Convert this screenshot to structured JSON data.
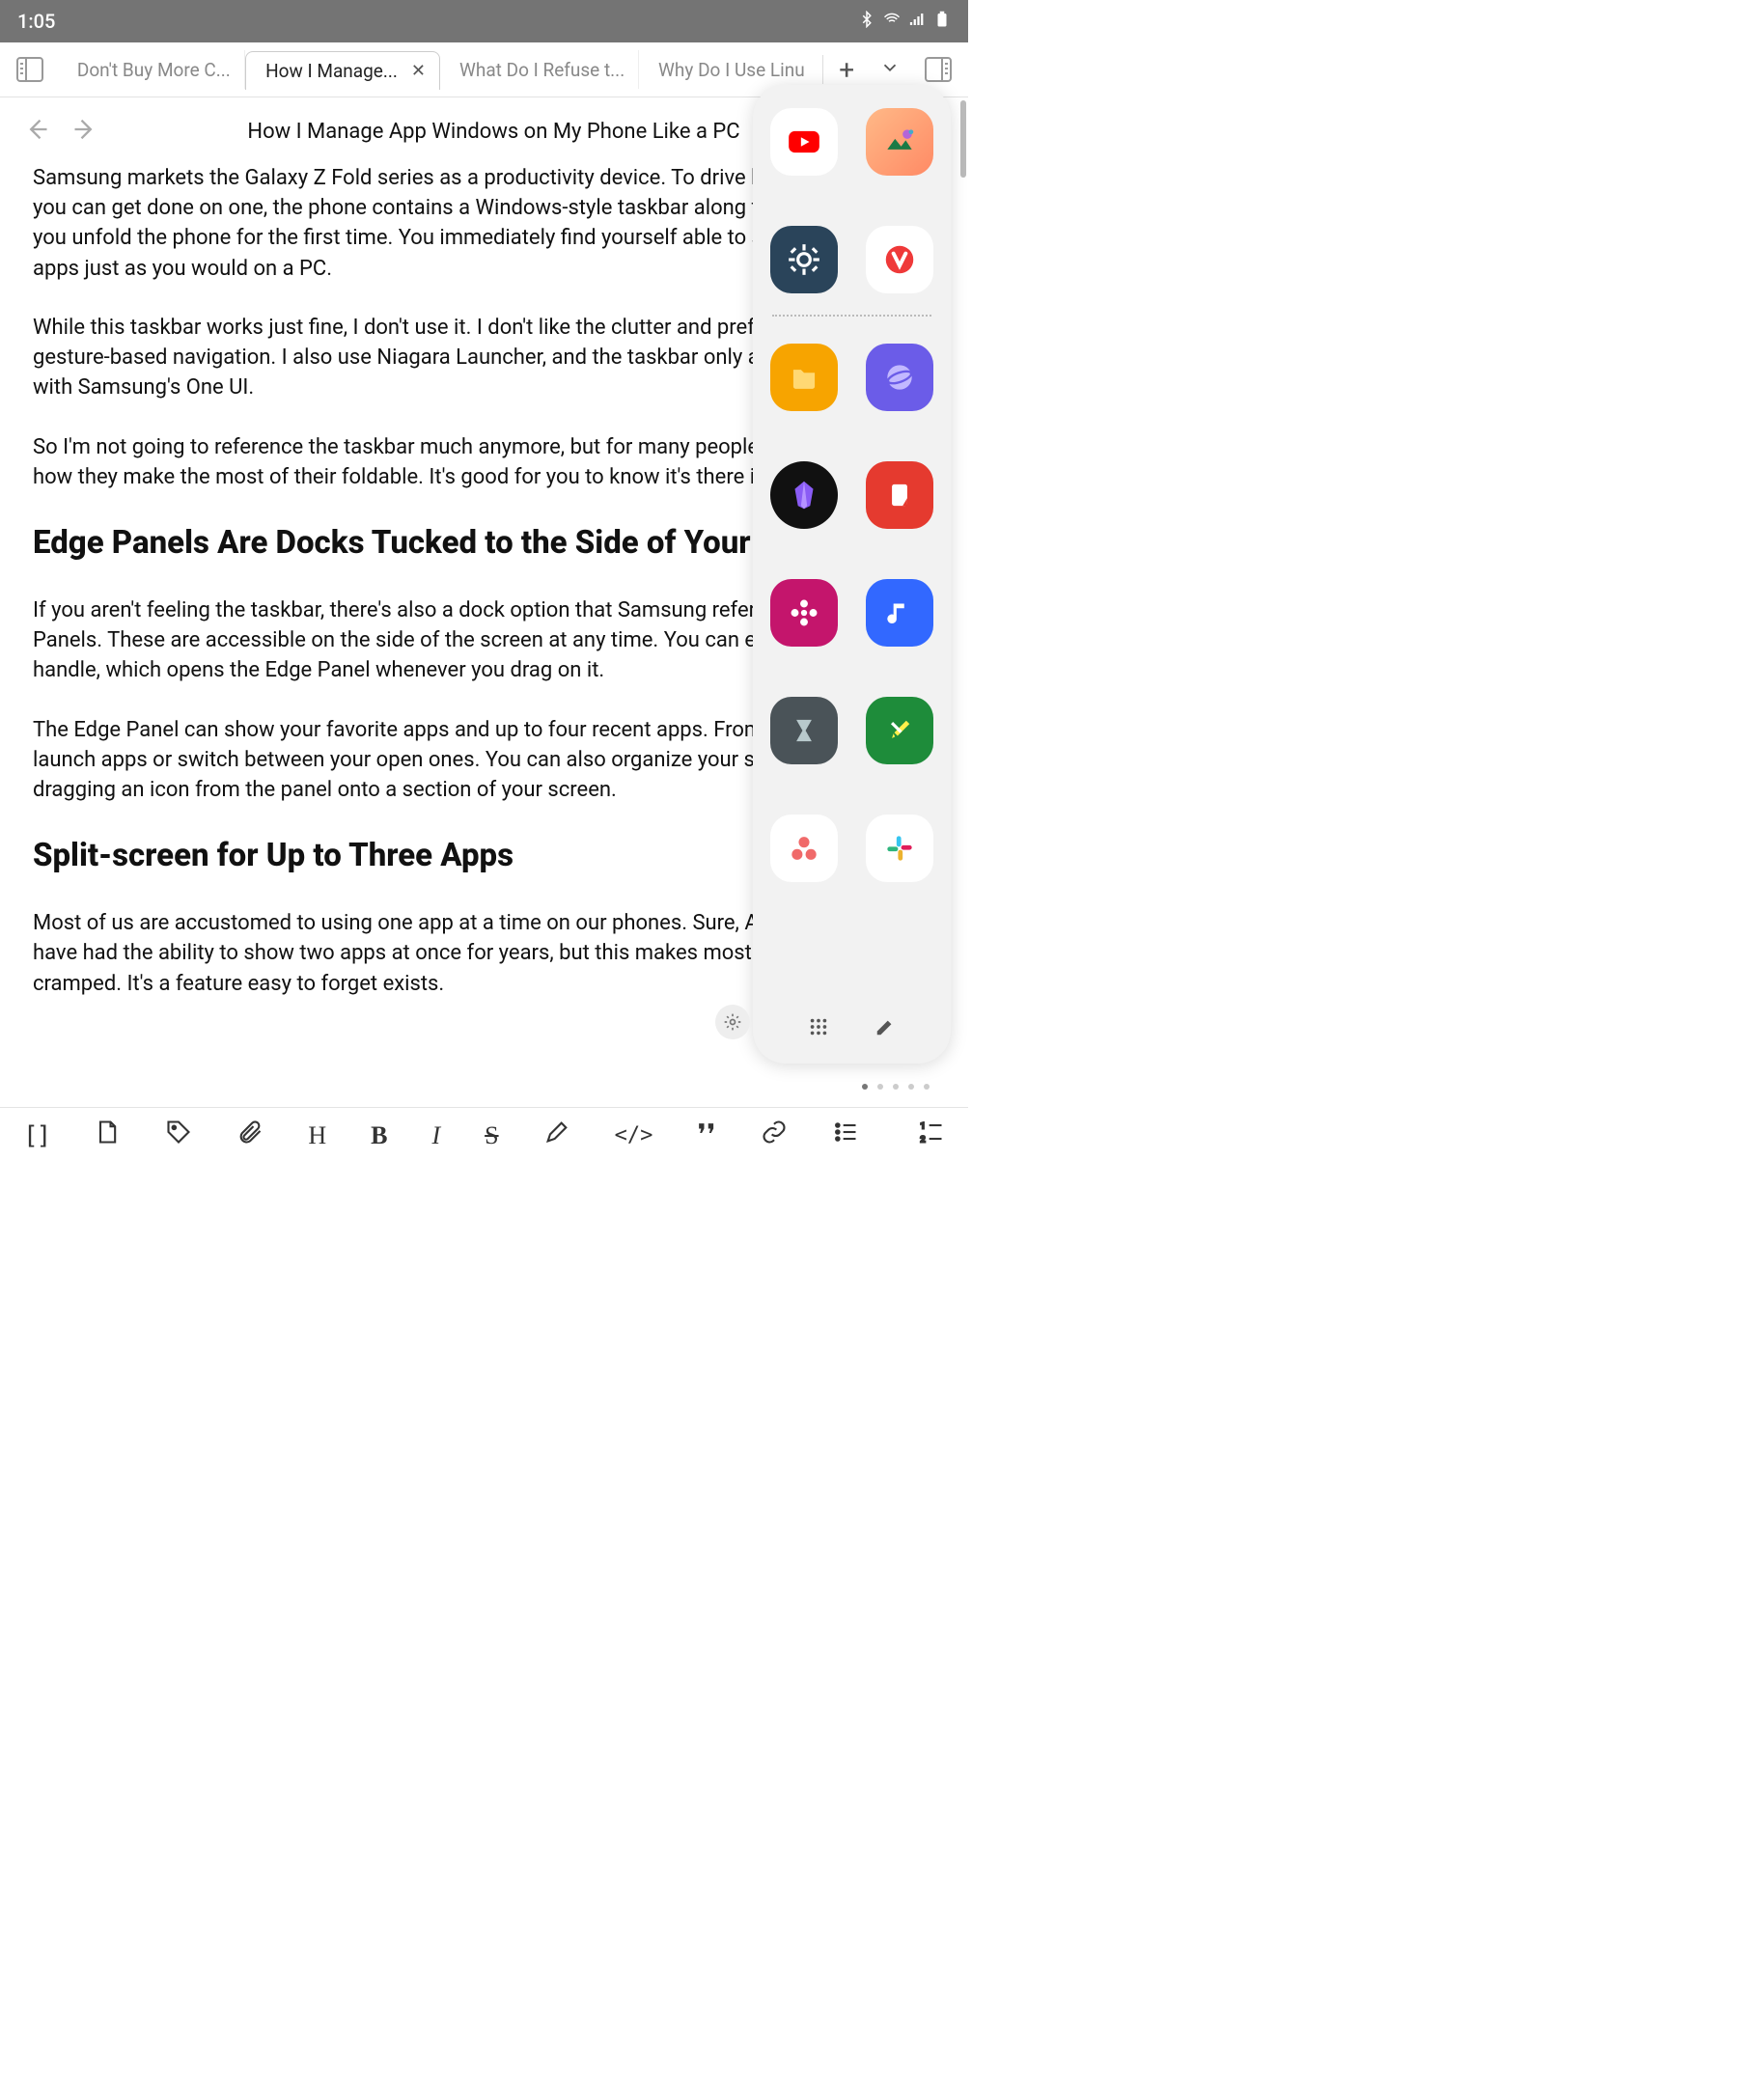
{
  "status": {
    "time": "1:05",
    "bluetooth": true,
    "wifi": "6",
    "signal": true,
    "battery": true
  },
  "tabs": {
    "items": [
      {
        "label": "Don't Buy More C...",
        "active": false
      },
      {
        "label": "How I Manage...",
        "active": true
      },
      {
        "label": "What Do I Refuse t...",
        "active": false
      },
      {
        "label": "Why Do I Use Linu",
        "active": false
      }
    ]
  },
  "page": {
    "title": "How I Manage App Windows on My Phone Like a PC"
  },
  "content": {
    "p1": "Samsung markets the Galaxy Z Fold series as a productivity device. To drive home how much you can get done on one, the phone contains a Windows-style taskbar along the bottom when you unfold the phone for the first time. You immediately find yourself able to switch between apps just as you would on a PC.",
    "p2": "While this taskbar works just fine, I don't use it. I don't like the clutter and prefer sticking with gesture-based navigation. I also use Niagara Launcher, and the taskbar only appears if you stick with Samsung's One UI.",
    "p3": "So I'm not going to reference the taskbar much anymore, but for many people, it's a core part of how they make the most of their foldable. It's good for you to know it's there in case you want it.",
    "h2a": "Edge Panels Are Docks Tucked to the Side of Your Screen",
    "p4": "If you aren't feeling the taskbar, there's also a dock option that Samsung refers to as Edge Panels. These are accessible on the side of the screen at any time. You can enable a small handle, which opens the Edge Panel whenever you drag on it.",
    "p5": "The Edge Panel can show your favorite apps and up to four recent apps. From here, you can launch apps or switch between your open ones. You can also organize your split-screen by dragging an icon from the panel onto a section of your screen.",
    "h2b": "Split-screen for Up to Three Apps",
    "p6": "Most of us are accustomed to using one app at a time on our phones. Sure, Android phones have had the ability to show two apps at once for years, but this makes most phones feel cramped. It's a feature easy to forget exists."
  },
  "edge_panel": {
    "recent": [
      {
        "name": "YouTube",
        "bg": "#ffffff",
        "accent": "#ff0000"
      },
      {
        "name": "Game",
        "bg": "#f5a05a",
        "accent": "#2aa36a"
      },
      {
        "name": "Settings",
        "bg": "#2a445a",
        "accent": "#ffffff"
      },
      {
        "name": "Vivaldi",
        "bg": "#ffffff",
        "accent": "#ef3939"
      }
    ],
    "apps": [
      {
        "name": "Files",
        "bg": "#f7a400",
        "accent": "#ffd873"
      },
      {
        "name": "Internet",
        "bg": "#6b5ce8",
        "accent": "#c2b8ff"
      },
      {
        "name": "Obsidian",
        "bg": "#111111",
        "accent": "#8a5cf5"
      },
      {
        "name": "Notes",
        "bg": "#e53a2f",
        "accent": "#ffffff"
      },
      {
        "name": "Gallery",
        "bg": "#c4156c",
        "accent": "#ffffff"
      },
      {
        "name": "Music",
        "bg": "#3268ff",
        "accent": "#ffffff"
      },
      {
        "name": "Hourglass",
        "bg": "#4a5358",
        "accent": "#b8c9cc"
      },
      {
        "name": "Editor",
        "bg": "#1e8c3a",
        "accent": "#fff04a"
      },
      {
        "name": "Asana",
        "bg": "#ffffff",
        "accent": "#f06a6a"
      },
      {
        "name": "Slack",
        "bg": "#ffffff",
        "accent": "#36c5f0"
      }
    ],
    "page_dots": 5,
    "active_dot": 0
  },
  "toolbar": {
    "brackets": "[]",
    "heading": "H",
    "bold": "B",
    "italic": "I",
    "strike": "S",
    "code": "</>",
    "quote": "❞"
  }
}
